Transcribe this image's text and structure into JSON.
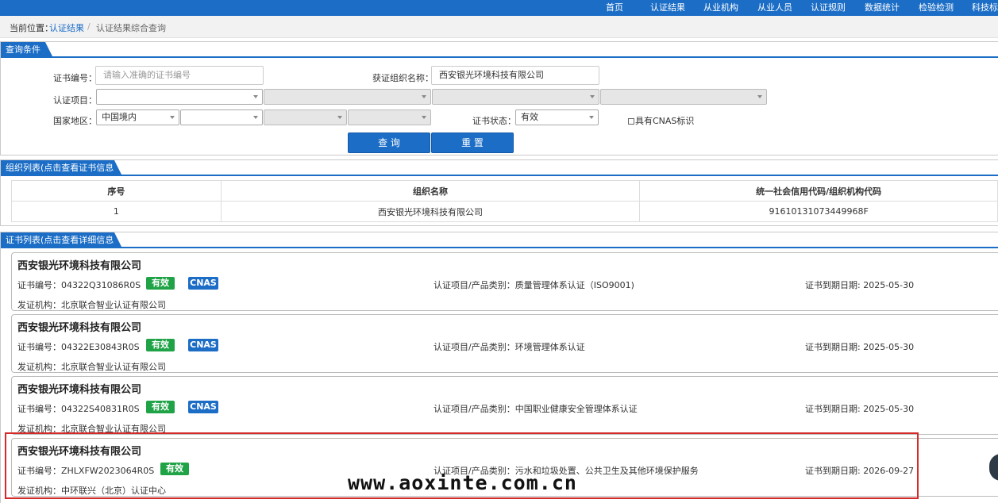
{
  "nav": {
    "items": [
      "首页",
      "认证结果",
      "从业机构",
      "从业人员",
      "认证规则",
      "数据统计",
      "检验检测",
      "科技标"
    ]
  },
  "breadcrumb": {
    "label": "当前位置：",
    "link": "认证结果",
    "sep": "/",
    "current": "认证结果综合查询"
  },
  "query": {
    "title": "查询条件",
    "cert_no_label": "证书编号：",
    "cert_no_placeholder": "请输入准确的证书编号",
    "org_name_label": "获证组织名称：",
    "org_name_value": "西安银光环境科技有限公司",
    "item_label": "认证项目：",
    "region_label": "国家地区：",
    "region_value": "中国境内",
    "status_label": "证书状态：",
    "status_value": "有效",
    "cnas_label": "具有CNAS标识",
    "query_button": "查 询",
    "reset_button": "重 置"
  },
  "org_list": {
    "title": "组织列表(点击查看证书信息)",
    "headers": [
      "序号",
      "组织名称",
      "统一社会信用代码/组织机构代码"
    ],
    "rows": [
      {
        "index": "1",
        "name": "西安银光环境科技有限公司",
        "code": "91610131073449968F"
      }
    ]
  },
  "cert_list": {
    "title": "证书列表(点击查看详细信息)",
    "cert_no_prefix": "证书编号：",
    "item_prefix": "认证项目/产品类别：",
    "expiry_prefix": "证书到期日期: ",
    "issuer_prefix": "发证机构：",
    "cards": [
      {
        "org": "西安银光环境科技有限公司",
        "cert_no": "04322Q31086R0S",
        "status": "有效",
        "cnas": "CNAS",
        "item": "质量管理体系认证（ISO9001)",
        "expiry": "2025-05-30",
        "issuer": "北京联合智业认证有限公司"
      },
      {
        "org": "西安银光环境科技有限公司",
        "cert_no": "04322E30843R0S",
        "status": "有效",
        "cnas": "CNAS",
        "item": "环境管理体系认证",
        "expiry": "2025-05-30",
        "issuer": "北京联合智业认证有限公司"
      },
      {
        "org": "西安银光环境科技有限公司",
        "cert_no": "04322S40831R0S",
        "status": "有效",
        "cnas": "CNAS",
        "item": "中国职业健康安全管理体系认证",
        "expiry": "2025-05-30",
        "issuer": "北京联合智业认证有限公司"
      },
      {
        "org": "西安银光环境科技有限公司",
        "cert_no": "ZHLXFW2023064R0S",
        "status": "有效",
        "cnas": "",
        "item": "污水和垃圾处置、公共卫生及其他环境保护服务",
        "expiry": "2026-09-27",
        "issuer": "中环联兴（北京）认证中心"
      }
    ]
  },
  "watermark": "www.aoxinte.com.cn",
  "colors": {
    "brand": "#1b6dc6",
    "valid": "#1fa346",
    "highlight": "#d42a2a"
  }
}
